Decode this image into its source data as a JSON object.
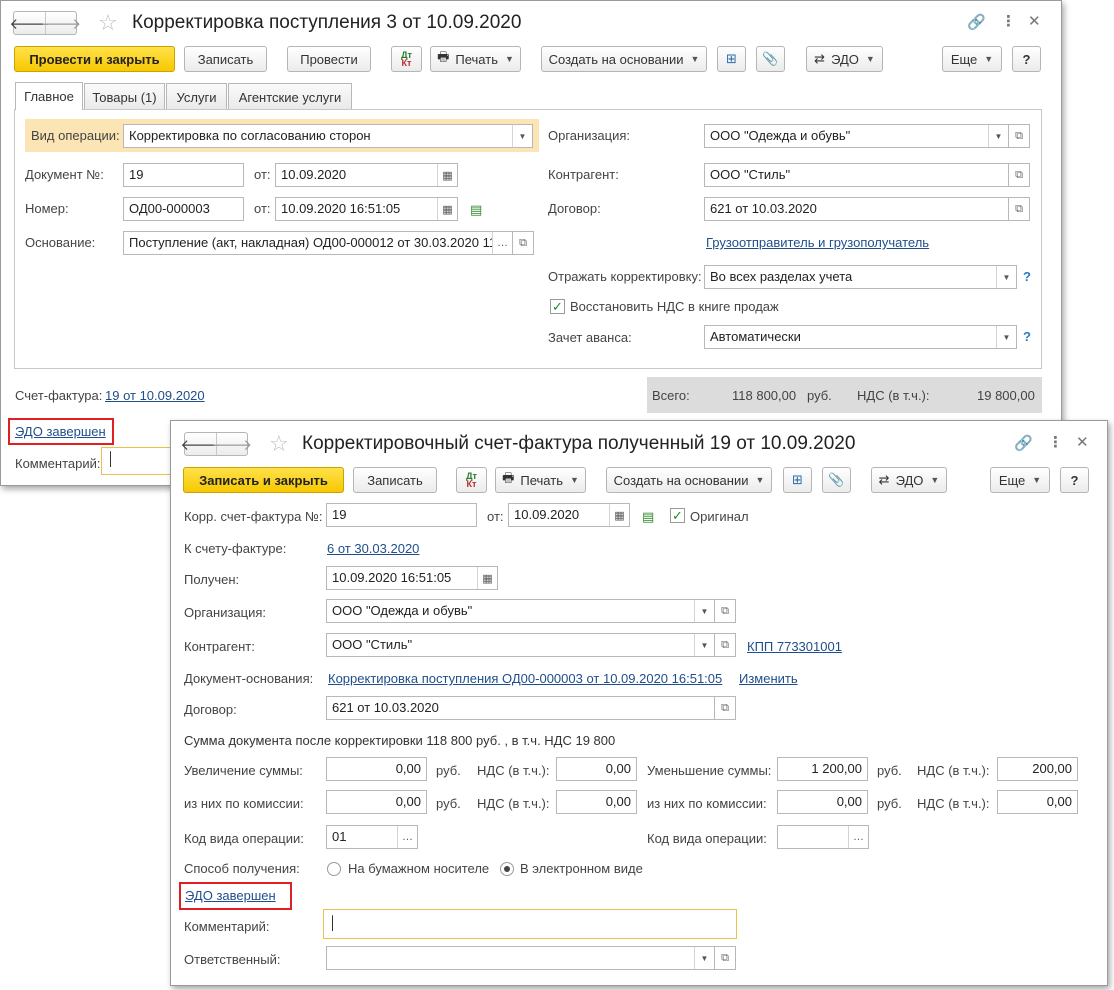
{
  "w1": {
    "title": "Корректировка поступления 3 от 10.09.2020",
    "toolbar": {
      "post_close": "Провести и закрыть",
      "save": "Записать",
      "post": "Провести",
      "print": "Печать",
      "create_based": "Создать на основании",
      "edo": "ЭДО",
      "more": "Еще",
      "help": "?",
      "dt": "Дт",
      "kt": "Кт"
    },
    "tabs": [
      "Главное",
      "Товары (1)",
      "Услуги",
      "Агентские услуги"
    ],
    "labels": {
      "op_type": "Вид операции:",
      "doc_no": "Документ №:",
      "from": "от:",
      "number": "Номер:",
      "basis": "Основание:",
      "org": "Организация:",
      "counterparty": "Контрагент:",
      "contract": "Договор:",
      "reflect": "Отражать корректировку:",
      "restore_vat": "Восстановить НДС в книге продаж",
      "advance": "Зачет аванса:",
      "invoice": "Счет-фактура:",
      "edo_done": "ЭДО завершен",
      "comment": "Комментарий:"
    },
    "values": {
      "op_type": "Корректировка по согласованию сторон",
      "doc_no": "19",
      "doc_date": "10.09.2020",
      "number": "ОД00-000003",
      "number_date": "10.09.2020 16:51:05",
      "basis": "Поступление (акт, накладная) ОД00-000012 от 30.03.2020 11",
      "org": "ООО \"Одежда и обувь\"",
      "counterparty": "ООО \"Стиль\"",
      "contract": "621 от 10.03.2020",
      "shipper_link": "Грузоотправитель и грузополучатель",
      "reflect": "Во всех разделах учета",
      "advance": "Автоматически",
      "invoice_link": "19 от 10.09.2020"
    },
    "totals": {
      "total_label": "Всего:",
      "total": "118 800,00",
      "currency": "руб.",
      "vat_label": "НДС (в т.ч.):",
      "vat": "19 800,00"
    }
  },
  "w2": {
    "title": "Корректировочный счет-фактура полученный 19 от 10.09.2020",
    "toolbar": {
      "save_close": "Записать и закрыть",
      "save": "Записать",
      "print": "Печать",
      "create_based": "Создать на основании",
      "edo": "ЭДО",
      "more": "Еще",
      "help": "?",
      "dt": "Дт",
      "kt": "Кт"
    },
    "labels": {
      "corr_no": "Корр. счет-фактура №:",
      "from": "от:",
      "original": "Оригинал",
      "to_invoice": "К счету-фактуре:",
      "received": "Получен:",
      "org": "Организация:",
      "counterparty": "Контрагент:",
      "basis_doc": "Документ-основания:",
      "change": "Изменить",
      "contract": "Договор:",
      "sum_after": "Сумма документа после корректировки 118 800 руб. , в т.ч. НДС 19 800",
      "increase": "Увеличение суммы:",
      "decrease": "Уменьшение суммы:",
      "commission": "из них по комиссии:",
      "rub": "руб.",
      "vat_incl": "НДС (в т.ч.):",
      "op_code": "Код вида операции:",
      "method": "Способ получения:",
      "paper": "На бумажном носителе",
      "electronic": "В электронном виде",
      "edo_done": "ЭДО завершен",
      "comment": "Комментарий:",
      "responsible": "Ответственный:"
    },
    "values": {
      "corr_no": "19",
      "corr_date": "10.09.2020",
      "to_invoice": "6 от 30.03.2020",
      "received": "10.09.2020 16:51:05",
      "org": "ООО \"Одежда и обувь\"",
      "counterparty": "ООО \"Стиль\"",
      "kpp": "КПП 773301001",
      "basis_doc": "Корректировка поступления ОД00-000003 от 10.09.2020 16:51:05",
      "contract": "621 от 10.03.2020",
      "inc_sum": "0,00",
      "inc_vat": "0,00",
      "dec_sum": "1 200,00",
      "dec_vat": "200,00",
      "inc_comm_sum": "0,00",
      "inc_comm_vat": "0,00",
      "dec_comm_sum": "0,00",
      "dec_comm_vat": "0,00",
      "op_code_left": "01",
      "op_code_right": "",
      "comment": "",
      "responsible": ""
    }
  },
  "colors": {
    "primary_button": "#f7c800",
    "highlight_field": "#fbe5b4",
    "edo_box": "#e02020",
    "link": "#1f4e8c",
    "check": "#1d8a1d"
  },
  "icons": [
    "arrow-left-icon",
    "arrow-right-icon",
    "star-icon",
    "link-icon",
    "more-vert-icon",
    "close-icon",
    "printer-icon",
    "structure-icon",
    "paperclip-icon",
    "edo-icon",
    "calendar-icon",
    "dropdown-caret-icon",
    "open-form-icon",
    "checkmark-icon",
    "question-icon"
  ]
}
